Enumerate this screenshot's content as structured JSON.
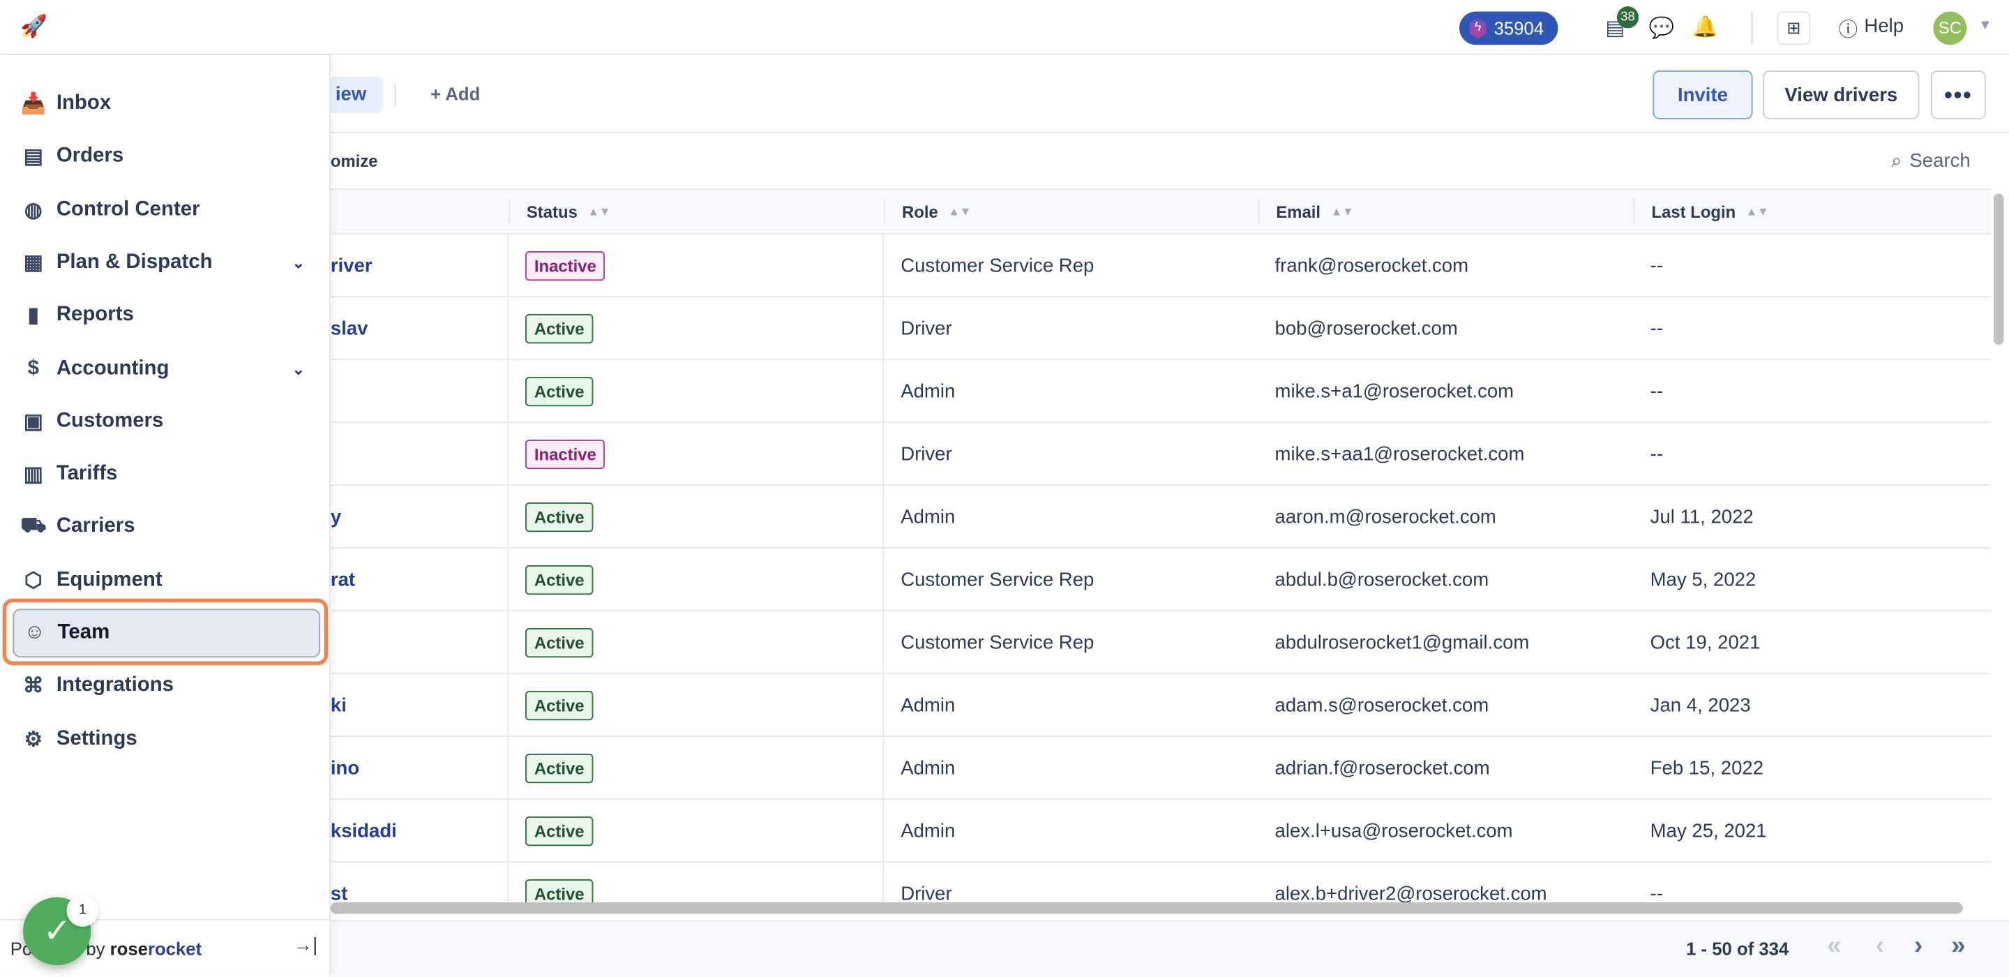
{
  "topbar": {
    "points": "35904",
    "notes_badge": "38",
    "help": "Help",
    "avatar": "SC"
  },
  "toolbar": {
    "view_tab": "iew",
    "add": "+ Add",
    "invite": "Invite",
    "view_drivers": "View drivers",
    "more": "•••",
    "customize": "omize",
    "search": "Search"
  },
  "table": {
    "columns": [
      "Status",
      "Role",
      "Email",
      "Last Login"
    ],
    "rows": [
      {
        "name": "river",
        "status": "Inactive",
        "role": "Customer Service Rep",
        "email": "frank@roserocket.com",
        "last_login": "--"
      },
      {
        "name": "slav",
        "status": "Active",
        "role": "Driver",
        "email": "bob@roserocket.com",
        "last_login": "--"
      },
      {
        "name": "",
        "status": "Active",
        "role": "Admin",
        "email": "mike.s+a1@roserocket.com",
        "last_login": "--"
      },
      {
        "name": "",
        "status": "Inactive",
        "role": "Driver",
        "email": "mike.s+aa1@roserocket.com",
        "last_login": "--"
      },
      {
        "name": "y",
        "status": "Active",
        "role": "Admin",
        "email": "aaron.m@roserocket.com",
        "last_login": "Jul 11, 2022"
      },
      {
        "name": "rat",
        "status": "Active",
        "role": "Customer Service Rep",
        "email": "abdul.b@roserocket.com",
        "last_login": "May 5, 2022"
      },
      {
        "name": "",
        "status": "Active",
        "role": "Customer Service Rep",
        "email": "abdulroserocket1@gmail.com",
        "last_login": "Oct 19, 2021"
      },
      {
        "name": "ki",
        "status": "Active",
        "role": "Admin",
        "email": "adam.s@roserocket.com",
        "last_login": "Jan 4, 2023"
      },
      {
        "name": "ino",
        "status": "Active",
        "role": "Admin",
        "email": "adrian.f@roserocket.com",
        "last_login": "Feb 15, 2022"
      },
      {
        "name": "ksidadi",
        "status": "Active",
        "role": "Admin",
        "email": "alex.l+usa@roserocket.com",
        "last_login": "May 25, 2021"
      },
      {
        "name": "st",
        "status": "Active",
        "role": "Driver",
        "email": "alex.b+driver2@roserocket.com",
        "last_login": "--"
      }
    ]
  },
  "pagination": {
    "info": "1 - 50 of 334"
  },
  "sidebar": {
    "items": [
      {
        "label": "Inbox",
        "icon": "inbox-icon",
        "glyph": "📥"
      },
      {
        "label": "Orders",
        "icon": "document-icon",
        "glyph": "▤"
      },
      {
        "label": "Control Center",
        "icon": "globe-icon",
        "glyph": "◍"
      },
      {
        "label": "Plan & Dispatch",
        "icon": "calendar-icon",
        "glyph": "▦",
        "chevron": true
      },
      {
        "label": "Reports",
        "icon": "bar-chart-icon",
        "glyph": "▮"
      },
      {
        "label": "Accounting",
        "icon": "dollar-icon",
        "glyph": "$",
        "chevron": true
      },
      {
        "label": "Customers",
        "icon": "customer-card-icon",
        "glyph": "▣"
      },
      {
        "label": "Tariffs",
        "icon": "tariff-icon",
        "glyph": "▥"
      },
      {
        "label": "Carriers",
        "icon": "truck-icon",
        "glyph": "⛟"
      },
      {
        "label": "Equipment",
        "icon": "box-icon",
        "glyph": "⬡"
      },
      {
        "label": "Team",
        "icon": "team-icon",
        "glyph": "☺",
        "selected": true
      },
      {
        "label": "Integrations",
        "icon": "integrations-icon",
        "glyph": "⌘"
      },
      {
        "label": "Settings",
        "icon": "gear-icon",
        "glyph": "⚙"
      }
    ],
    "powered_prefix": "Powered by",
    "brand_a": "rose",
    "brand_b": "rocket",
    "fab_badge": "1"
  },
  "colors": {
    "accent": "#2f57b8",
    "active": "#2f6f3b",
    "inactive": "#b0368e",
    "highlight": "#f0834f"
  }
}
